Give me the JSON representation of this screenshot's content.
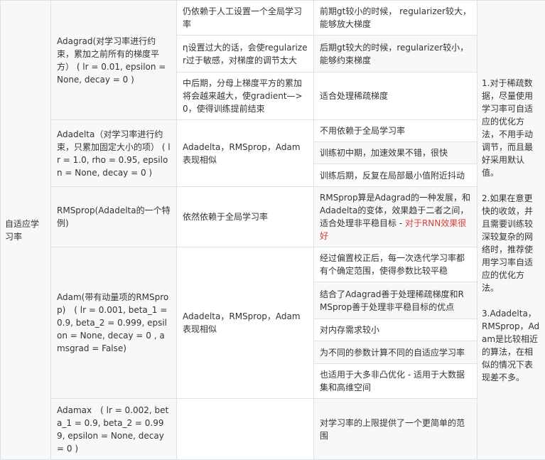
{
  "category": "自适应学习率",
  "adagrad": {
    "name": "Adagrad(对学习率进行约束，累加之前所有的梯度平方） ( lr = 0.01, epsilon = None, decay = 0 )",
    "rows": [
      {
        "feature": "仍依赖于人工设置一个全局学习率",
        "effect": "前期gt较小的时候， regularizer较大，能够放大梯度"
      },
      {
        "feature": "η设置过大的话，会使regularizer过于敏感，对梯度的调节太大",
        "effect": "后期gt较大的时候，regularizer较小，能够约束梯度"
      },
      {
        "feature": "中后期，分母上梯度平方的累加将会越来越大，使gradient—>0，使得训练提前结束",
        "effect": "适合处理稀疏梯度"
      }
    ]
  },
  "adadelta": {
    "name": "Adadelta（对学习率进行约束，只累加固定大小的项） ( lr = 1.0, rho = 0.95, epsilon = None, decay = 0 )",
    "feature": "Adadelta，RMSprop，Adam表现相似",
    "effects": [
      "不用依赖于全局学习率",
      "训练初中期，加速效果不错，很快",
      "训练后期，反复在局部最小值附近抖动"
    ]
  },
  "rmsprop": {
    "name": "RMSprop(Adadelta的一个特例)",
    "feature": "依然依赖于全局学习率",
    "effect": "RMSprop算是Adagrad的一种发展，和Adadelta的变体，效果趋于二者之间，适合处理非平稳目标 - ",
    "effect_highlight": "对于RNN效果很好"
  },
  "adam": {
    "name": "Adam(带有动量项的RMSprop)　( lr = 0.001, beta_1 = 0.9, beta_2 = 0.999, epsilon = None, decay = 0 , amsgrad = False)",
    "feature": "Adadelta，RMSprop，Adam表现相似",
    "effects": [
      "经过偏置校正后，每一次迭代学习率都有个确定范围，使得参数比较平稳",
      "结合了Adagrad善于处理稀疏梯度和RMSprop善于处理非平稳目标的优点",
      "对内存需求较小",
      "为不同的参数计算不同的自适应学习率",
      "也适用于大多非凸优化 - 适用于大数据集和高维空间"
    ]
  },
  "adamax": {
    "name": "Adamax　( lr = 0.002, beta_1 = 0.9, beta_2 = 0.999, epsilon = None, decay = 0 )",
    "feature": "",
    "effect": "对学习率的上限提供了一个更简单的范围"
  },
  "notes": [
    "1.对于稀疏数据，尽量使用学习率可自适应的优化方法，不用手动调节，而且最好采用默认值。",
    "2.如果在意更快的收敛，并且需要训练较深较复杂的网络时，推荐使用学习率自适应的优化方法。",
    "3.Adadelta，RMSprop，Adam是比较相近的算法，在相似的情况下表现差不多。"
  ]
}
